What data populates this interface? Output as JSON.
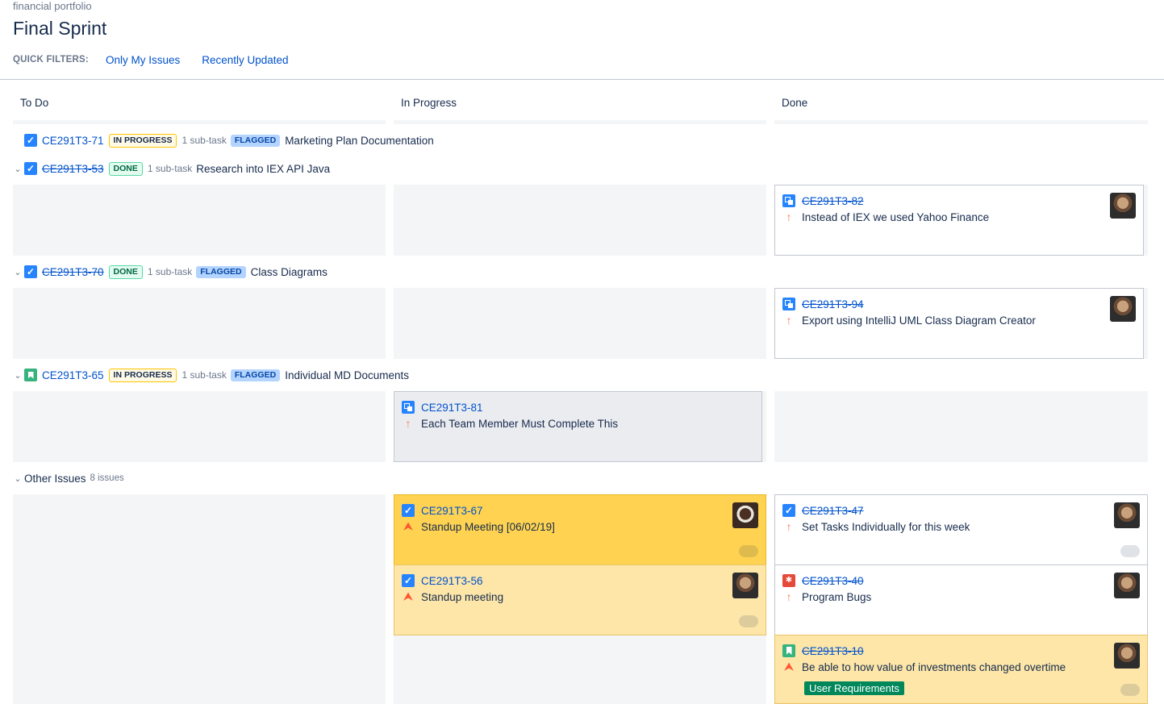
{
  "breadcrumb": "financial portfolio",
  "title": "Final Sprint",
  "quick_filters": {
    "label": "QUICK FILTERS:",
    "items": [
      "Only My Issues",
      "Recently Updated"
    ]
  },
  "columns": [
    "To Do",
    "In Progress",
    "Done"
  ],
  "swimlanes": [
    {
      "key": "CE291T3-71",
      "status": "IN PROGRESS",
      "subtasks": "1 sub-task",
      "flag": "FLAGGED",
      "summary": "Marketing Plan Documentation"
    },
    {
      "key": "CE291T3-53",
      "status": "DONE",
      "subtasks": "1 sub-task",
      "summary": "Research into IEX API Java"
    },
    {
      "key": "CE291T3-70",
      "status": "DONE",
      "subtasks": "1 sub-task",
      "flag": "FLAGGED",
      "summary": "Class Diagrams"
    },
    {
      "key": "CE291T3-65",
      "status": "IN PROGRESS",
      "subtasks": "1 sub-task",
      "flag": "FLAGGED",
      "summary": "Individual MD Documents"
    }
  ],
  "other": {
    "label": "Other Issues",
    "count": "8 issues"
  },
  "cards": {
    "c82": {
      "key": "CE291T3-82",
      "summary": "Instead of IEX we used Yahoo Finance"
    },
    "c94": {
      "key": "CE291T3-94",
      "summary": "Export using IntelliJ UML Class Diagram Creator"
    },
    "c81": {
      "key": "CE291T3-81",
      "summary": "Each Team Member Must Complete This"
    },
    "c67": {
      "key": "CE291T3-67",
      "summary": "Standup Meeting [06/02/19]"
    },
    "c56": {
      "key": "CE291T3-56",
      "summary": "Standup meeting"
    },
    "c47": {
      "key": "CE291T3-47",
      "summary": "Set Tasks Individually for this week"
    },
    "c40": {
      "key": "CE291T3-40",
      "summary": "Program Bugs"
    },
    "c10": {
      "key": "CE291T3-10",
      "summary": "Be able to how value of investments changed overtime",
      "epic": "User Requirements"
    }
  },
  "icons": {
    "chevron": "chevron-down-icon",
    "task": "checkbox-icon",
    "story": "bookmark-icon",
    "subtask": "subtask-icon",
    "bug": "bug-icon",
    "priority_medium": "arrow-up-icon",
    "priority_highest": "double-chevron-up-icon"
  },
  "colors": {
    "link": "#0052cc",
    "flagged_card": "#ffd351",
    "flagged_card_light": "#fde6a8",
    "epic": "#00875a"
  }
}
